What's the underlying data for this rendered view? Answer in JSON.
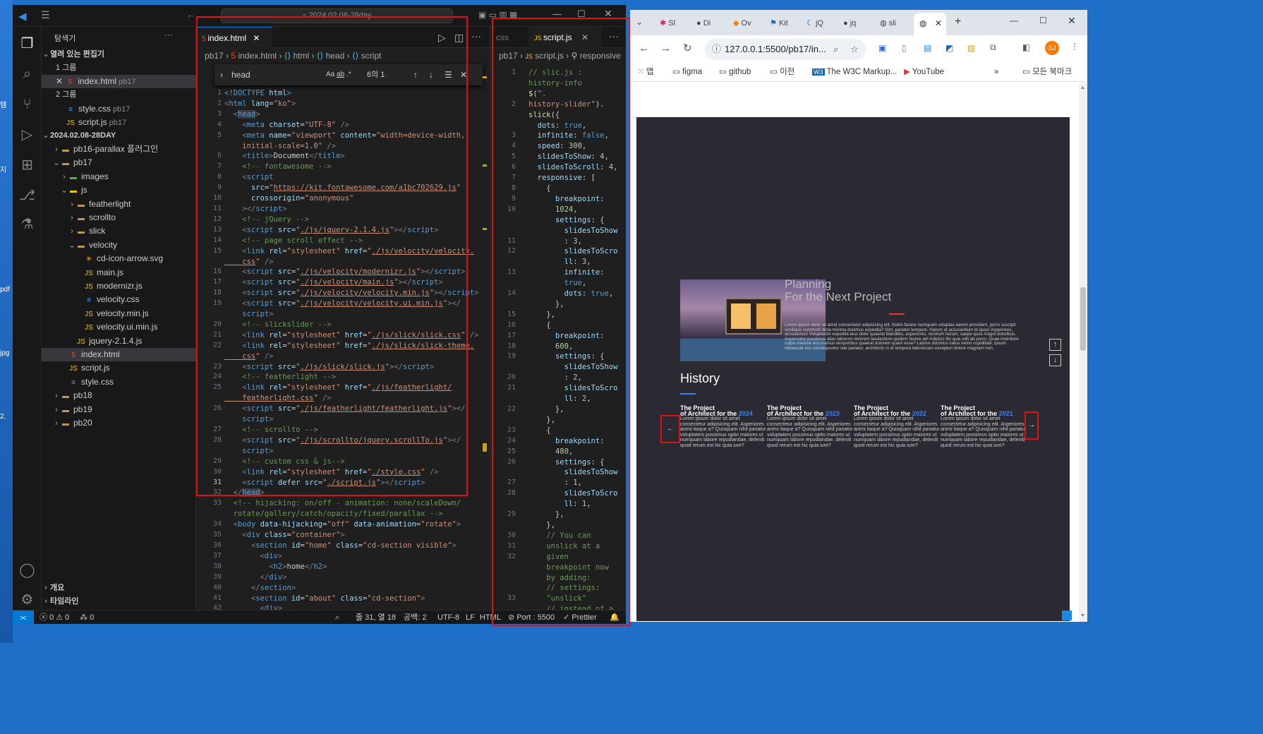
{
  "desktop": {
    "labels": [
      "템",
      "지",
      "pdf",
      "jpg",
      "2."
    ]
  },
  "vscode": {
    "search_placeholder": "2024.02.08-28day",
    "explorer_title": "탐색기",
    "open_editors": "열려 있는 편집기",
    "group1": "1 그룹",
    "group2": "2 그룹",
    "open_files": [
      {
        "name": "index.html",
        "dir": "pb17",
        "icon": "html"
      },
      {
        "name": "style.css",
        "dir": "pb17",
        "icon": "css"
      },
      {
        "name": "script.js",
        "dir": "pb17",
        "icon": "js"
      }
    ],
    "workspace": "2024.02.08-28DAY",
    "tree": [
      {
        "label": "pb16-parallax 플러그인",
        "depth": 1,
        "kind": "folder",
        "open": false
      },
      {
        "label": "pb17",
        "depth": 1,
        "kind": "folder",
        "open": true
      },
      {
        "label": "images",
        "depth": 2,
        "kind": "folder-img",
        "open": false
      },
      {
        "label": "js",
        "depth": 2,
        "kind": "folder-js",
        "open": true
      },
      {
        "label": "featherlight",
        "depth": 3,
        "kind": "folder",
        "open": false
      },
      {
        "label": "scrollto",
        "depth": 3,
        "kind": "folder",
        "open": false
      },
      {
        "label": "slick",
        "depth": 3,
        "kind": "folder",
        "open": false
      },
      {
        "label": "velocity",
        "depth": 3,
        "kind": "folder",
        "open": true
      },
      {
        "label": "cd-icon-arrow.svg",
        "depth": 4,
        "kind": "svg"
      },
      {
        "label": "main.js",
        "depth": 4,
        "kind": "js"
      },
      {
        "label": "modernizr.js",
        "depth": 4,
        "kind": "js"
      },
      {
        "label": "velocity.css",
        "depth": 4,
        "kind": "css"
      },
      {
        "label": "velocity.min.js",
        "depth": 4,
        "kind": "js"
      },
      {
        "label": "velocity.ui.min.js",
        "depth": 4,
        "kind": "js"
      },
      {
        "label": "jquery-2.1.4.js",
        "depth": 3,
        "kind": "js"
      },
      {
        "label": "index.html",
        "depth": 2,
        "kind": "html",
        "selected": true
      },
      {
        "label": "script.js",
        "depth": 2,
        "kind": "js"
      },
      {
        "label": "style.css",
        "depth": 2,
        "kind": "css"
      },
      {
        "label": "pb18",
        "depth": 1,
        "kind": "folder",
        "open": false
      },
      {
        "label": "pb19",
        "depth": 1,
        "kind": "folder",
        "open": false
      },
      {
        "label": "pb20",
        "depth": 1,
        "kind": "folder",
        "open": false
      }
    ],
    "outline": "개요",
    "timeline": "타임라인",
    "editor1": {
      "tab": "index.html",
      "breadcrumb": [
        "pb17",
        "index.html",
        "html",
        "head",
        "script"
      ],
      "find_text": "head",
      "find_count": "6의 1"
    },
    "editor2": {
      "tab_prev": "css",
      "tab": "script.js",
      "breadcrumb": [
        "pb17",
        "script.js",
        "responsive"
      ]
    },
    "status": {
      "errors": "0",
      "warnings": "0",
      "ports": "0",
      "position": "줄 31, 열 18",
      "spaces": "공백: 2",
      "encoding": "UTF-8",
      "eol": "LF",
      "language": "HTML",
      "port": "Port : 5500",
      "formatter": "Prettier"
    }
  },
  "chrome": {
    "tabs": [
      "Sl",
      "Di",
      "Ov",
      "Kit",
      "jQ",
      "jq",
      "sli"
    ],
    "url": "127.0.0.1:5500/pb17/in...",
    "bookmarks": [
      "앱",
      "figma",
      "github",
      "이전",
      "The W3C Markup...",
      "YouTube"
    ],
    "all_bookmarks": "모든 북마크",
    "page": {
      "title_line1": "Planning",
      "title_line2": "For the Next Project",
      "body_text": "Lorem ipsum dolor sit amet consectetur adipisicing elit. Nobis facere numquam voluptas earum provident, porro suscipit similique commodi dicta minima ducimus expedita? Sint, pariatur tempore. Harum ut accusantium id quas! Asperiores, accusamus! Voluptatum expedita eius dolor quaerat blanditiis, asperiores, nostrum harum, saepe quos magni doloribus. Aspernatur possimus alias laborum dolorem laudantium quidem facere ad! Adipisci illo quia odit ab porro. Quae inventore culpa maxime accusamus temporibus quaerat dolorem quam esse? Labore ducimus natus nemo cupiditate, ipsum obcaecati eos consequuntur iste pariatur, architecto in et tempora laboriosam excepturi dolore magnam non.",
      "history_title": "History",
      "cards": [
        {
          "line1": "The Project",
          "line2": "of Architect for the",
          "year": "2024"
        },
        {
          "line1": "The Project",
          "line2": "of Architect for the",
          "year": "2023"
        },
        {
          "line1": "The Project",
          "line2": "of Architect for the",
          "year": "2022"
        },
        {
          "line1": "The Project",
          "line2": "of Architect for the",
          "year": "2021"
        }
      ],
      "card_text": "Lorem ipsum dolor sit amet consectetur adipisicing elit. Asperiores animi itaque a? Quisquam nihil pariatur voluptatem possimus optio maiores ut numquam labore repudiandae, deleniti quod rerum est hic quia iure?",
      "prev_arrow": "←",
      "next_arrow": "→"
    }
  },
  "colors": {
    "accent_blue": "#0078d4",
    "red_highlight": "#e01010",
    "history_year": "#3b82f6",
    "underline_red": "#e53935"
  }
}
